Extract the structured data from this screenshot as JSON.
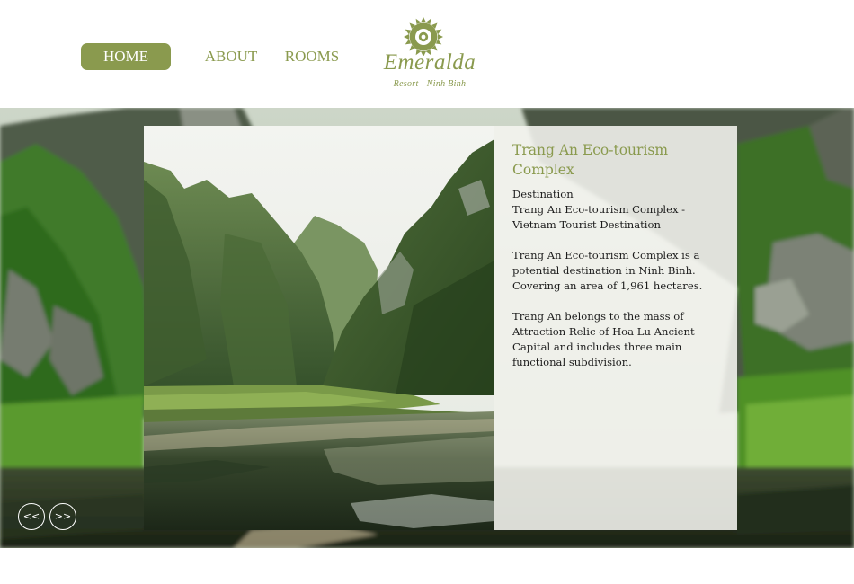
{
  "nav": {
    "items": [
      {
        "label": "HOME",
        "active": true
      },
      {
        "label": "ABOUT",
        "active": false
      },
      {
        "label": "ROOMS",
        "active": false
      }
    ]
  },
  "logo": {
    "icon": "sun-ring-icon",
    "name": "Emeralda",
    "subtitle": "Resort - Ninh Binh"
  },
  "slide": {
    "image": "river-karst-mountains-photo",
    "title": "Trang An Eco-tourism Complex",
    "lines": [
      "Destination",
      "Trang An Eco-tourism Complex -",
      "Vietnam Tourist Destination"
    ],
    "paragraph1": [
      "Trang An Eco-tourism Complex is a",
      "potential destination in Ninh Binh.",
      "Covering an area of 1,961 hectares."
    ],
    "paragraph2": [
      "Trang An belongs to the mass of",
      "Attraction Relic of Hoa Lu Ancient",
      "Capital and includes three main",
      "functional subdivision."
    ]
  },
  "controls": {
    "prev_label": "<<",
    "next_label": ">>"
  },
  "colors": {
    "accent": "#8a9a4e",
    "panel": "#f5f5f0",
    "text": "#1c1c1c"
  }
}
